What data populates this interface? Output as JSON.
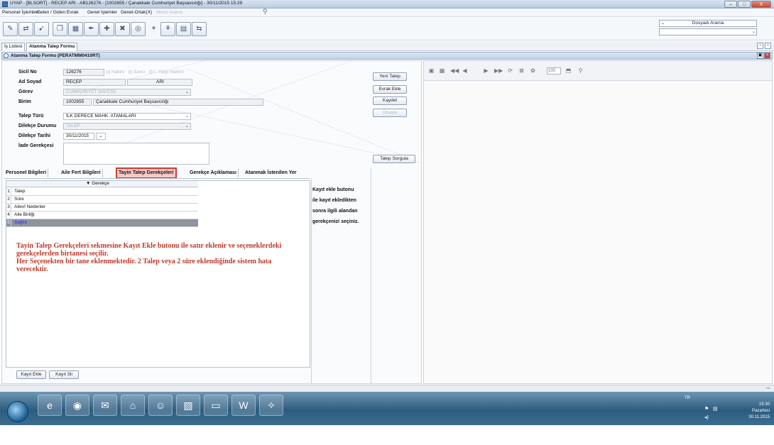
{
  "window": {
    "title": "UYAP - [BLSORT] - RECEP ARI - AB126276 - [1002655 / Çanakkale Cumhuriyet Başsavcılığı] - 30/11/2015 15:29",
    "controls": [
      "–",
      "□",
      "X"
    ]
  },
  "menu": {
    "items": [
      "Personel İşlemleri",
      "Gelen / Giden Evrak",
      "Genel İşlemler",
      "Genel-Ortak(X)"
    ],
    "search_placeholder": "Menü Arama"
  },
  "toolbar": {
    "icons": [
      "folder-open-icon",
      "refresh-icon",
      "send-icon",
      "copy-icon",
      "calculator-icon",
      "pen-icon",
      "user-add-icon",
      "user-remove-icon",
      "web-icon",
      "circle-icon",
      "help-icon",
      "grid-icon",
      "transfer-icon"
    ],
    "document_search_label": "Dosyadı Arama"
  },
  "tabs": [
    {
      "label": "İş Listesi",
      "active": false
    },
    {
      "label": "Atanma Talep Formu",
      "active": true
    }
  ],
  "form": {
    "header_title": "Atanma Talep Formu (PERATMM0410RT)",
    "fields": {
      "sicil_no_label": "Sicil No",
      "sicil_no": "126276",
      "radio_hakim": "Hakim",
      "radio_savci": "Savcı",
      "radio_yargi": "I. Yargı Hakimi",
      "ad_soyad_label": "Ad Soyad",
      "ad": "RECEP",
      "soyad": "ARI",
      "gorev_label": "Görev",
      "gorev": "CUMHURİYET SAVCISI",
      "birim_label": "Birim",
      "birim_kod": "1002655",
      "birim_ad": "Çanakkale Cumhuriyet Başsavcılığı",
      "talep_turu_label": "Talep Türü",
      "talep_turu": "İLK DERECE MAHK. ATAMALARI",
      "dilekce_durumu_label": "Dilekçe Durumu",
      "dilekce_durumu": "TALEP",
      "dilekce_tarihi_label": "Dilekçe Tarihi",
      "dilekce_tarihi": "30/11/2015",
      "iade_gerekcesi_label": "İade Gerekçesi"
    },
    "buttons": {
      "yeni_talep": "Yeni Talep",
      "evrak_ekle": "Evrak Ekle",
      "kaydet": "Kaydet",
      "onayla": "Onayla",
      "talep_sorgula": "Talep Sorgula",
      "kayit_ekle": "Kayıt Ekle",
      "kayit_sil": "Kayıt Sil"
    },
    "subtabs": [
      "Personel Bilgileri",
      "Aile Fert Bilgileri",
      "Tayin Talep Gerekçeleri",
      "Gerekçe Açıklaması",
      "Atanmak İstenilen Yer"
    ],
    "active_subtab": "Tayin Talep Gerekçeleri",
    "grid": {
      "header": "▼ Gerekçe",
      "rows": [
        {
          "no": "1",
          "value": "Talep"
        },
        {
          "no": "2",
          "value": "Süre"
        },
        {
          "no": "3",
          "value": "Ailevî Nedenler"
        },
        {
          "no": "4",
          "value": "Aile Birliği"
        },
        {
          "no": "5",
          "value": "Sağlık",
          "selected": true
        }
      ]
    },
    "hint_lines": [
      "Kayıt ekle butonu",
      "ile kayıt ekledikten",
      "sonra ilgili alandan",
      "gerekçenizi seçiniz."
    ],
    "note_lines": [
      "Tayin Talep Gerekçeleri sekmesine Kayıt Ekle butonu ile satır eklenir ve seçeneklerdeki",
      "gerekçelerden birtanesi seçilir.",
      "Her Seçenekten bir tane eklenmektedir. 2 Talep veya 2 süre eklendiğinde sistem hata",
      "verecektir."
    ]
  },
  "viewer": {
    "zoom": "100"
  },
  "taskbar": {
    "apps": [
      "internet-explorer-icon",
      "chrome-icon",
      "outlook-icon",
      "network-icon",
      "people-icon",
      "photo-icon",
      "folder-icon",
      "word-icon",
      "misc-icon"
    ],
    "lang": "TR",
    "time": "15:30",
    "day": "Pazartesi",
    "date": "30.11.2015"
  }
}
